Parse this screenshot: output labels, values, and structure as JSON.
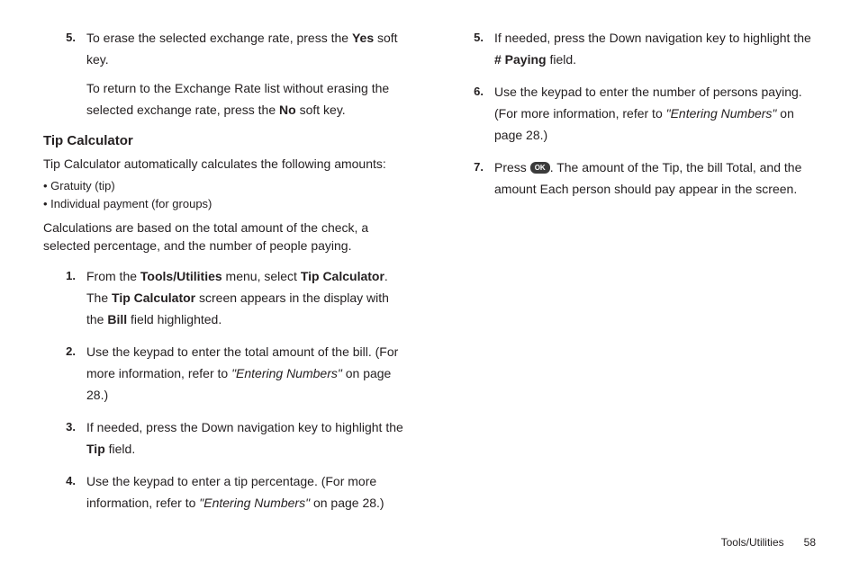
{
  "left": {
    "top_items": [
      {
        "num": "5.",
        "paras": [
          [
            {
              "t": "To erase the selected exchange rate, press the "
            },
            {
              "t": "Yes",
              "b": true
            },
            {
              "t": " soft key."
            }
          ],
          [
            {
              "t": "To return to the Exchange Rate list without erasing the selected exchange rate, press the "
            },
            {
              "t": "No",
              "b": true
            },
            {
              "t": " soft key."
            }
          ]
        ]
      }
    ],
    "heading": "Tip Calculator",
    "intro": "Tip Calculator automatically calculates the following amounts:",
    "bullets": [
      "Gratuity (tip)",
      "Individual payment (for groups)"
    ],
    "basis": "Calculations are based on the total amount of the check, a selected percentage, and the number of people paying.",
    "items": [
      {
        "num": "1.",
        "paras": [
          [
            {
              "t": "From the "
            },
            {
              "t": "Tools/Utilities",
              "b": true
            },
            {
              "t": " menu, select "
            },
            {
              "t": "Tip Calculator",
              "b": true
            },
            {
              "t": ". The "
            },
            {
              "t": "Tip Calculator",
              "b": true
            },
            {
              "t": " screen appears in the display with the "
            },
            {
              "t": "Bill",
              "b": true
            },
            {
              "t": " field highlighted."
            }
          ]
        ]
      },
      {
        "num": "2.",
        "paras": [
          [
            {
              "t": "Use the keypad to enter the total amount of the bill. (For more information, refer to "
            },
            {
              "t": "\"Entering Numbers\"",
              "i": true
            },
            {
              "t": "  on page 28.)"
            }
          ]
        ]
      },
      {
        "num": "3.",
        "paras": [
          [
            {
              "t": "If needed, press the Down navigation key to highlight the "
            },
            {
              "t": "Tip",
              "b": true
            },
            {
              "t": " field."
            }
          ]
        ]
      },
      {
        "num": "4.",
        "paras": [
          [
            {
              "t": "Use the keypad to enter a tip percentage. (For more information, refer to "
            },
            {
              "t": "\"Entering Numbers\"",
              "i": true
            },
            {
              "t": "  on page 28.)"
            }
          ]
        ]
      }
    ]
  },
  "right": {
    "items": [
      {
        "num": "5.",
        "paras": [
          [
            {
              "t": "If needed, press the Down navigation key to highlight the "
            },
            {
              "t": "# Paying",
              "b": true
            },
            {
              "t": " field."
            }
          ]
        ]
      },
      {
        "num": "6.",
        "paras": [
          [
            {
              "t": "Use the keypad to enter the number of persons paying. (For more information, refer to "
            },
            {
              "t": "\"Entering Numbers\"",
              "i": true
            },
            {
              "t": "  on page 28.)"
            }
          ]
        ]
      },
      {
        "num": "7.",
        "paras": [
          [
            {
              "t": "Press "
            },
            {
              "ok": true
            },
            {
              "t": ". The amount of the Tip, the bill Total, and the amount Each person should pay appear in the screen."
            }
          ]
        ]
      }
    ]
  },
  "footer": {
    "section": "Tools/Utilities",
    "page": "58"
  },
  "ok_label": "OK"
}
